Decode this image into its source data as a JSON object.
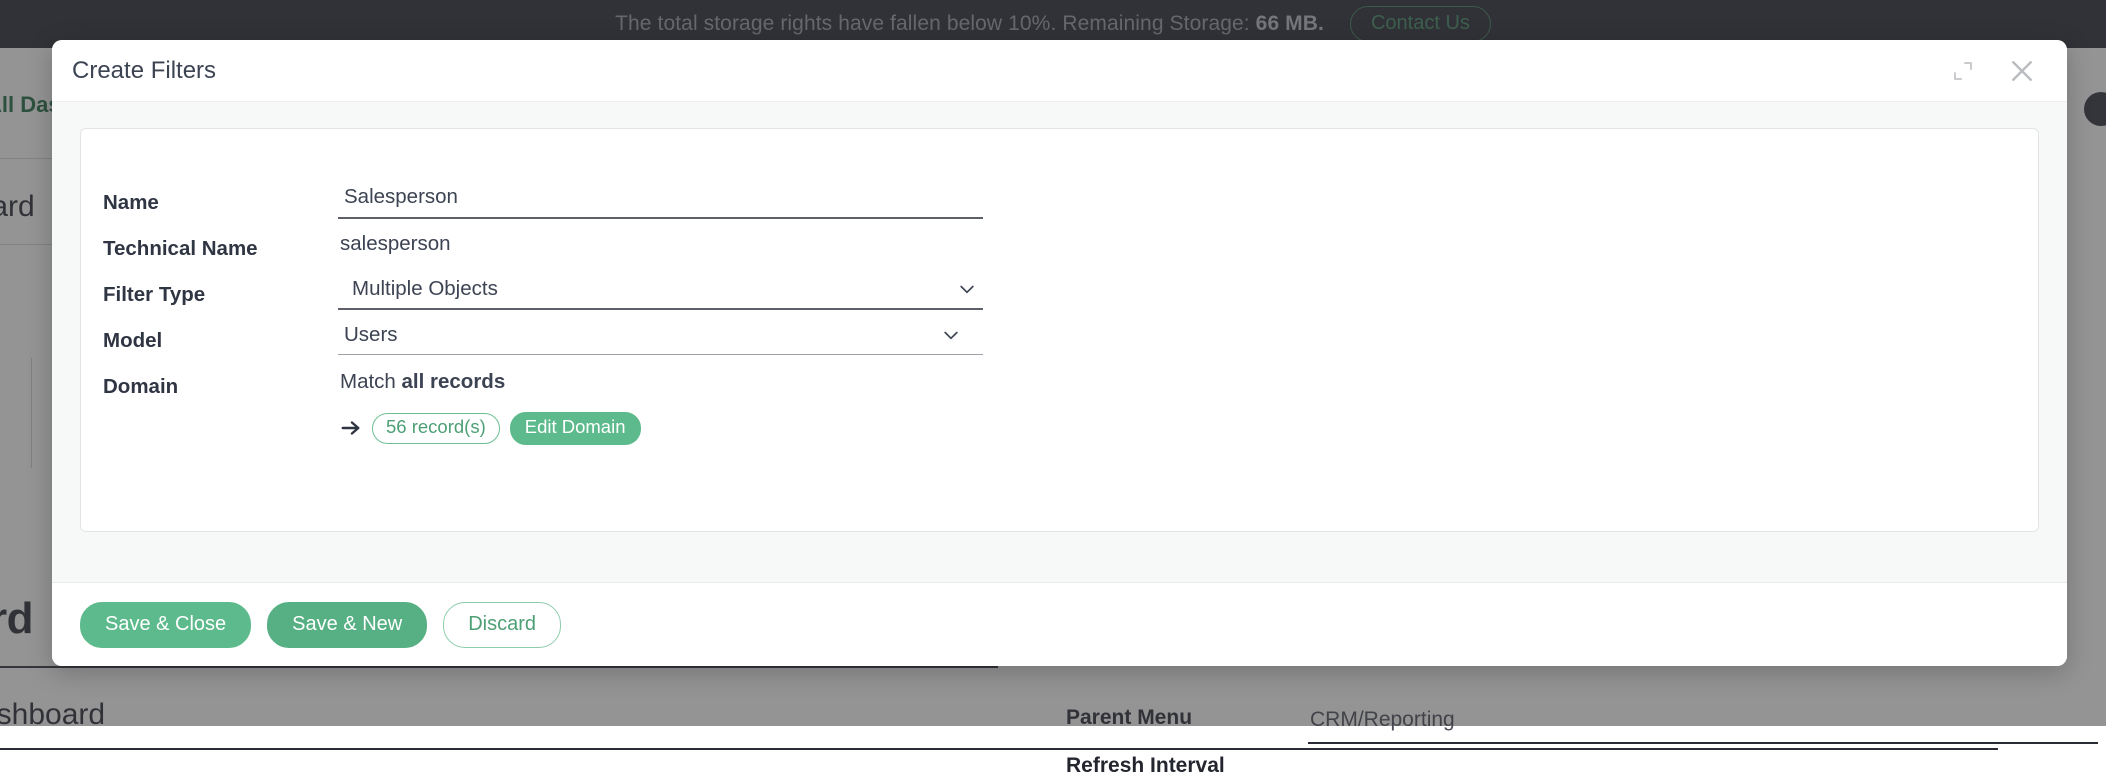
{
  "banner": {
    "message_before": "The total storage rights have fallen below 10%. Remaining Storage: ",
    "storage_value": "66 MB.",
    "contact_label": "Contact Us"
  },
  "background": {
    "all_dashboards_link": "All Das",
    "breadcrumb_fragment": "board",
    "page_title_fragment": "ard",
    "subtitle_fragment": "ashboard",
    "parent_menu_label": "Parent Menu",
    "parent_menu_value": "CRM/Reporting",
    "refresh_interval_label": "Refresh Interval"
  },
  "dialog": {
    "title": "Create Filters",
    "expand_icon": "expand-icon",
    "close_icon": "close-icon",
    "fields": {
      "name": {
        "label": "Name",
        "value": "Salesperson"
      },
      "technical_name": {
        "label": "Technical Name",
        "value": "salesperson"
      },
      "filter_type": {
        "label": "Filter Type",
        "value": "Multiple Objects",
        "options": [
          "Multiple Objects"
        ]
      },
      "model": {
        "label": "Model",
        "value": "Users",
        "options": [
          "Users"
        ]
      },
      "domain": {
        "label": "Domain",
        "match_prefix": "Match ",
        "match_target": "all records",
        "arrow_icon": "arrow-right-icon",
        "record_count_label": "56 record(s)",
        "edit_domain_label": "Edit Domain"
      }
    },
    "footer": {
      "save_close_label": "Save & Close",
      "save_new_label": "Save & New",
      "discard_label": "Discard"
    }
  },
  "colors": {
    "accent_green": "#5cba8c",
    "banner_bg": "#24262f",
    "link_green": "#1d6b42"
  }
}
